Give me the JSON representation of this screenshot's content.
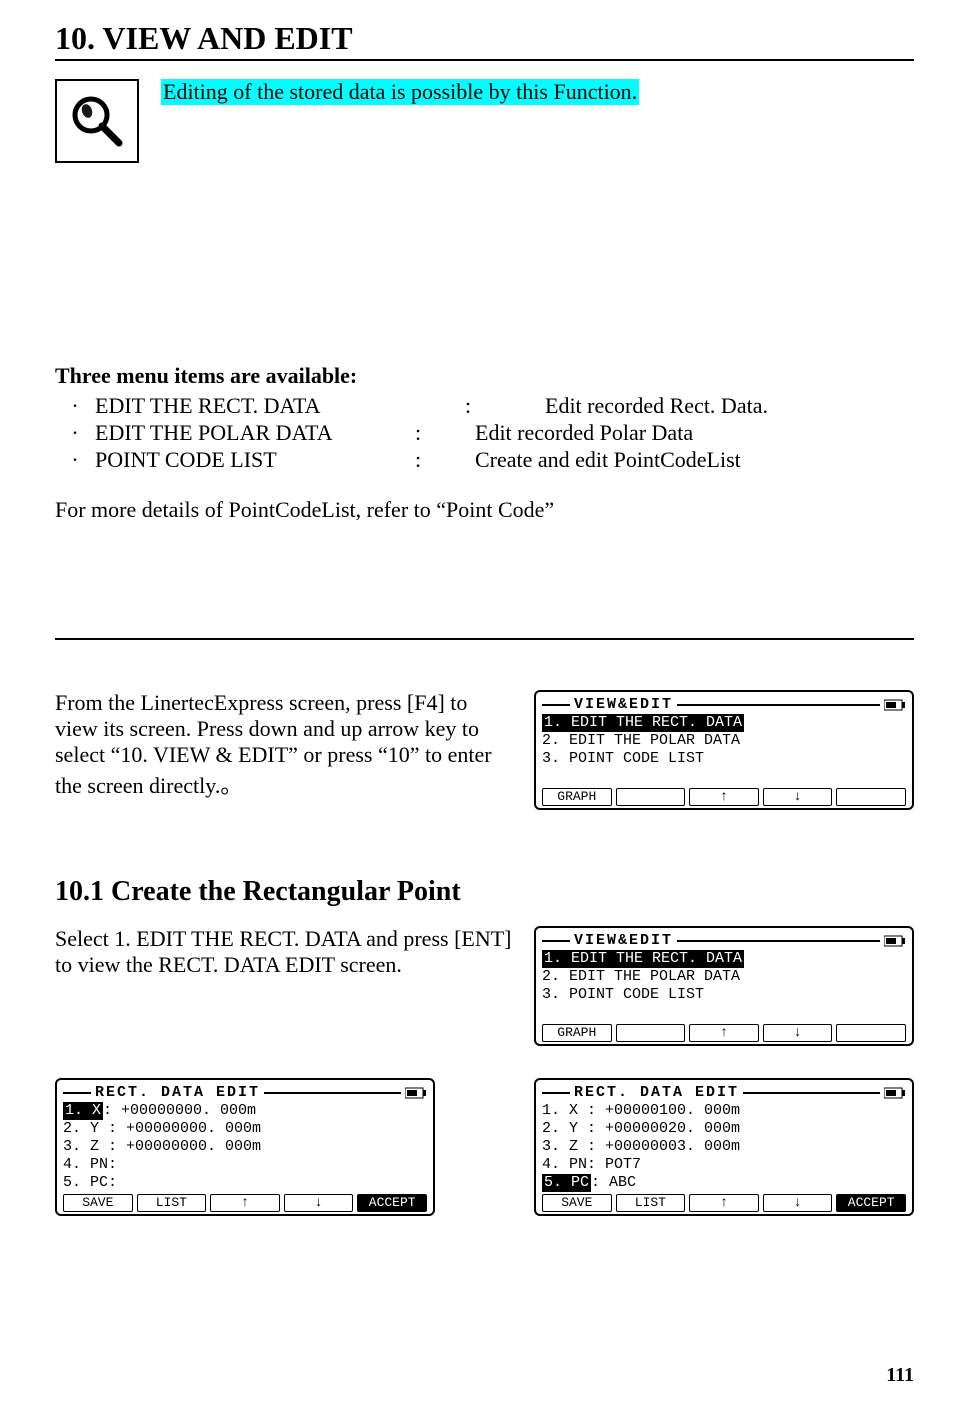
{
  "title": "10. VIEW AND EDIT",
  "intro_highlight": "Editing of the stored data is possible by this Function.",
  "menu_heading": "Three menu items are available:",
  "menu": [
    {
      "name": "EDIT THE RECT. DATA",
      "desc": "Edit recorded Rect. Data."
    },
    {
      "name": "EDIT THE POLAR DATA",
      "desc": "Edit recorded  Polar Data"
    },
    {
      "name": "POINT CODE LIST",
      "desc": "Create and edit PointCodeList"
    }
  ],
  "more_details": "For more details of PointCodeList, refer to “Point Code”",
  "instruction1": "From the LinertecExpress screen, press [F4] to view its screen. Press down and up arrow key to select “10. VIEW & EDIT” or press “10” to enter the screen directly.。",
  "section_10_1": "10.1 Create the Rectangular Point",
  "instruction2": "Select 1. EDIT THE RECT. DATA and press [ENT] to view the RECT. DATA EDIT screen.",
  "lcd_view_edit": {
    "header": "VIEW&EDIT",
    "items": [
      "1. EDIT THE RECT. DATA",
      "2. EDIT THE POLAR DATA",
      "3. POINT CODE LIST"
    ],
    "fkeys": [
      "GRAPH",
      "",
      "↑",
      "↓",
      ""
    ],
    "selected": 0
  },
  "lcd_rect_edit_a": {
    "header": "RECT. DATA EDIT",
    "rows": [
      {
        "label": "1. X",
        "value": "+00000000. 000m",
        "sel": true
      },
      {
        "label": "2. Y",
        "value": "+00000000. 000m",
        "sel": false
      },
      {
        "label": "3. Z",
        "value": "+00000000. 000m",
        "sel": false
      },
      {
        "label": "4. PN",
        "value": "",
        "sel": false
      },
      {
        "label": "5. PC",
        "value": "",
        "sel": false
      }
    ],
    "fkeys": [
      "SAVE",
      "LIST",
      "↑",
      "↓",
      "ACCEPT"
    ]
  },
  "lcd_rect_edit_b": {
    "header": "RECT. DATA EDIT",
    "rows": [
      {
        "label": "1. X",
        "value": "+00000100. 000m",
        "sel": false
      },
      {
        "label": "2. Y",
        "value": "+00000020. 000m",
        "sel": false
      },
      {
        "label": "3. Z",
        "value": "+00000003. 000m",
        "sel": false
      },
      {
        "label": "4. PN",
        "value": "POT7",
        "sel": false
      },
      {
        "label": "5. PC",
        "value": "ABC",
        "sel": true
      }
    ],
    "fkeys": [
      "SAVE",
      "LIST",
      "↑",
      "↓",
      "ACCEPT"
    ]
  },
  "page_number": "111"
}
